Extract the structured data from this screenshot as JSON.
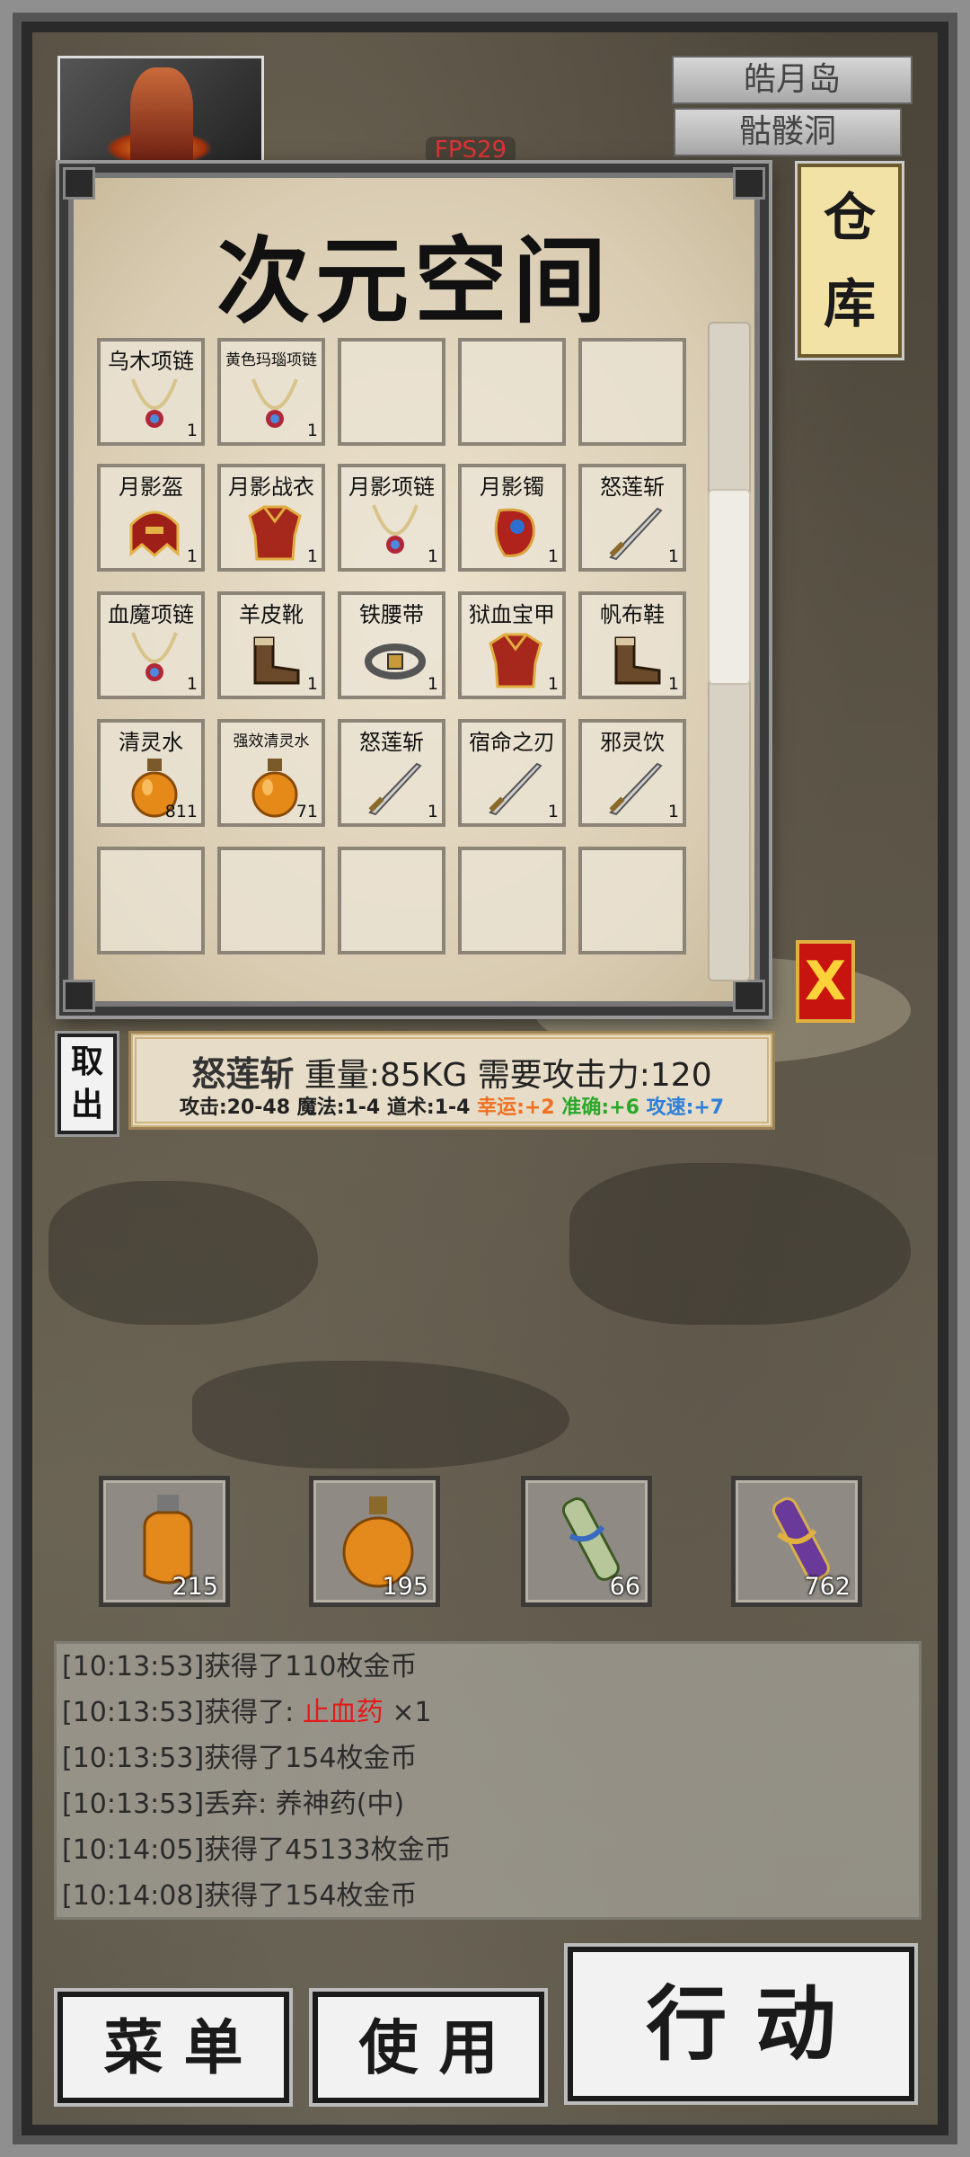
{
  "header": {
    "location_region": "皓月岛",
    "location_map": "骷髅洞",
    "fps": "FPS29"
  },
  "warehouse": {
    "title": "次元空间",
    "side_button": "仓库",
    "slots": [
      {
        "name": "乌木项链",
        "count": "1",
        "icon": "necklace-icon"
      },
      {
        "name": "黄色玛瑙项链",
        "count": "1",
        "icon": "necklace-icon"
      },
      {
        "name": "",
        "count": "",
        "icon": ""
      },
      {
        "name": "",
        "count": "",
        "icon": ""
      },
      {
        "name": "",
        "count": "",
        "icon": ""
      },
      {
        "name": "月影盔",
        "count": "1",
        "icon": "helmet-icon"
      },
      {
        "name": "月影战衣",
        "count": "1",
        "icon": "armor-icon"
      },
      {
        "name": "月影项链",
        "count": "1",
        "icon": "necklace-icon"
      },
      {
        "name": "月影镯",
        "count": "1",
        "icon": "bracelet-icon"
      },
      {
        "name": "怒莲斩",
        "count": "1",
        "icon": "sword-icon"
      },
      {
        "name": "血魔项链",
        "count": "1",
        "icon": "necklace-icon"
      },
      {
        "name": "羊皮靴",
        "count": "1",
        "icon": "boots-icon"
      },
      {
        "name": "铁腰带",
        "count": "1",
        "icon": "belt-icon"
      },
      {
        "name": "狱血宝甲",
        "count": "1",
        "icon": "armor-icon"
      },
      {
        "name": "帆布鞋",
        "count": "1",
        "icon": "boots-icon"
      },
      {
        "name": "清灵水",
        "count": "811",
        "icon": "potion-icon"
      },
      {
        "name": "强效清灵水",
        "count": "71",
        "icon": "potion-icon"
      },
      {
        "name": "怒莲斩",
        "count": "1",
        "icon": "sword-icon"
      },
      {
        "name": "宿命之刃",
        "count": "1",
        "icon": "sword-icon"
      },
      {
        "name": "邪灵饮",
        "count": "1",
        "icon": "sword-icon"
      },
      {
        "name": "",
        "count": "",
        "icon": ""
      },
      {
        "name": "",
        "count": "",
        "icon": ""
      },
      {
        "name": "",
        "count": "",
        "icon": ""
      },
      {
        "name": "",
        "count": "",
        "icon": ""
      },
      {
        "name": "",
        "count": "",
        "icon": ""
      }
    ],
    "close_label": "X",
    "take_out_label": "取出"
  },
  "item_info": {
    "name": "怒莲斩",
    "weight": "重量:85KG",
    "requirement": "需要攻击力:120",
    "stats_plain": "攻击:20-48 魔法:1-4 道术:1-4",
    "luck": "幸运:+2",
    "accuracy": "准确:+6",
    "speed": "攻速:+7"
  },
  "shortcuts": [
    {
      "count": "215",
      "icon": "potion-small-icon"
    },
    {
      "count": "195",
      "icon": "potion-round-icon"
    },
    {
      "count": "66",
      "icon": "scroll-green-icon"
    },
    {
      "count": "762",
      "icon": "scroll-purple-icon"
    }
  ],
  "log": [
    {
      "time": "[10:13:53]",
      "text": "获得了110枚金币",
      "highlight": "",
      "suffix": ""
    },
    {
      "time": "[10:13:53]",
      "text": "获得了: ",
      "highlight": "止血药",
      "suffix": " ×1"
    },
    {
      "time": "[10:13:53]",
      "text": "获得了154枚金币",
      "highlight": "",
      "suffix": ""
    },
    {
      "time": "[10:13:53]",
      "text": "丢弃: 养神药(中)",
      "highlight": "",
      "suffix": ""
    },
    {
      "time": "[10:14:05]",
      "text": "获得了45133枚金币",
      "highlight": "",
      "suffix": ""
    },
    {
      "time": "[10:14:08]",
      "text": "获得了154枚金币",
      "highlight": "",
      "suffix": ""
    }
  ],
  "buttons": {
    "menu": "菜 单",
    "use": "使 用",
    "action": "行 动"
  },
  "colors": {
    "luck": "#f07020",
    "accuracy": "#2aa82a",
    "speed": "#2f7fd8",
    "log_highlight": "#e21a1a",
    "close_button": "#c8140e"
  }
}
